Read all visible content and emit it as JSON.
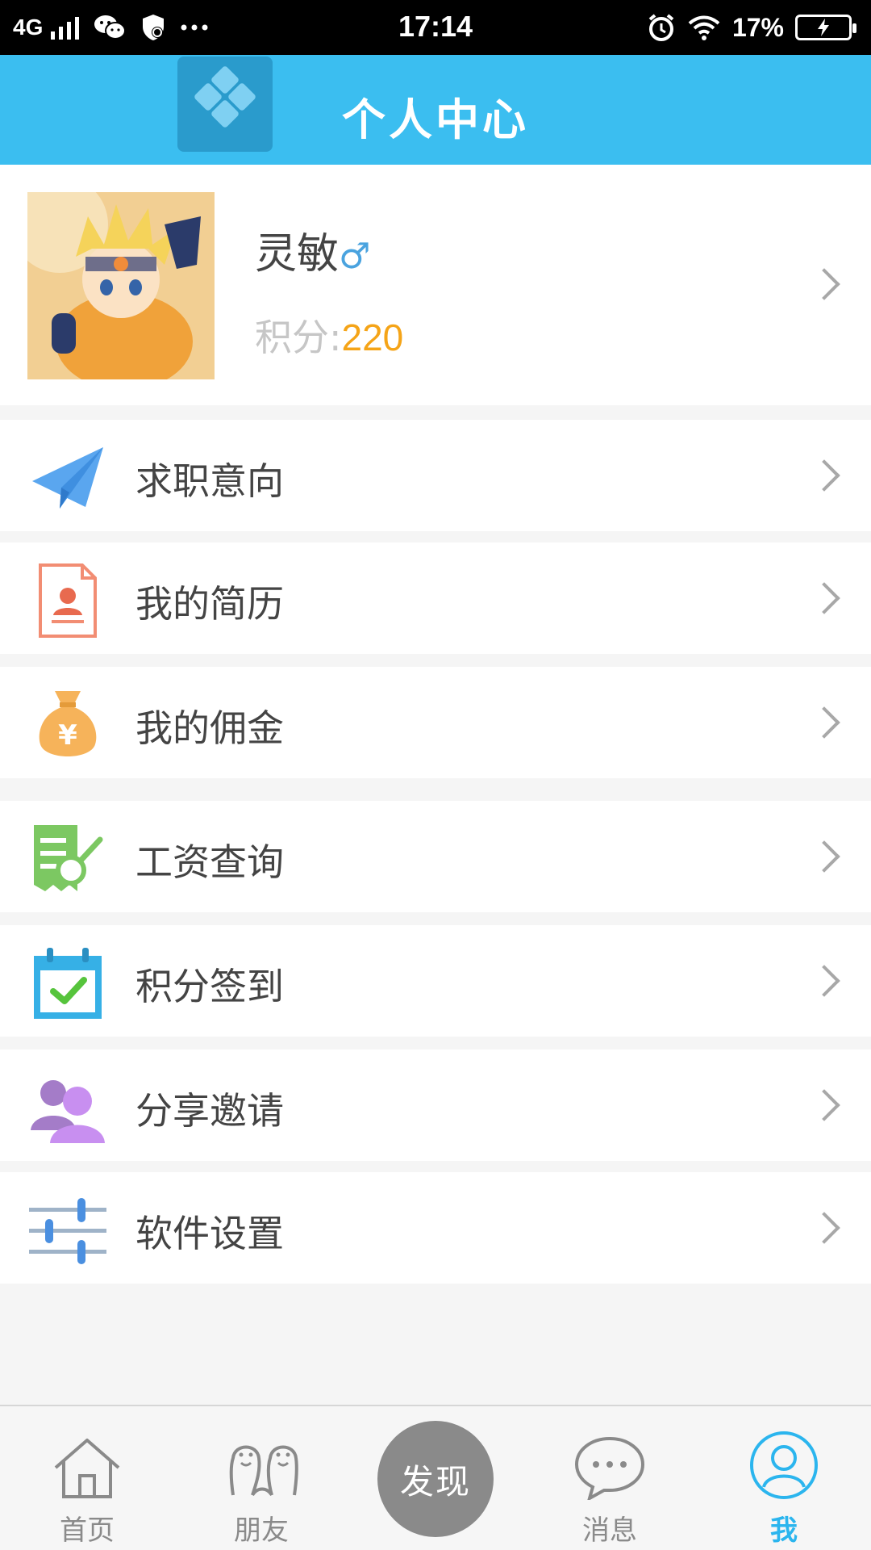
{
  "status_bar": {
    "network": "4G",
    "time": "17:14",
    "battery_percent": "17%",
    "icons": [
      "signal-icon",
      "wechat-icon",
      "shield-icon",
      "more-dots-icon",
      "alarm-icon",
      "wifi-icon",
      "battery-icon"
    ]
  },
  "header": {
    "title": "个人中心"
  },
  "profile": {
    "name": "灵敏",
    "gender_symbol": "♂",
    "points_label": "积分:",
    "points_value": "220"
  },
  "menu": [
    {
      "label": "求职意向",
      "icon": "paper-plane-icon",
      "color": "#5aa6ef"
    },
    {
      "label": "我的简历",
      "icon": "resume-icon",
      "color": "#f28d73"
    },
    {
      "label": "我的佣金",
      "icon": "money-bag-icon",
      "color": "#f6b35a"
    },
    {
      "label": "工资查询",
      "icon": "salary-search-icon",
      "color": "#7cc862"
    },
    {
      "label": "积分签到",
      "icon": "calendar-check-icon",
      "color": "#36b0e6"
    },
    {
      "label": "分享邀请",
      "icon": "people-icon",
      "color": "#b97ee0"
    },
    {
      "label": "软件设置",
      "icon": "sliders-icon",
      "color": "#4a8fe0"
    }
  ],
  "tabbar": {
    "tabs": [
      {
        "label": "首页",
        "icon": "home-icon"
      },
      {
        "label": "朋友",
        "icon": "friends-icon"
      },
      {
        "label": "发现",
        "icon": "discover-button"
      },
      {
        "label": "消息",
        "icon": "chat-icon"
      },
      {
        "label": "我",
        "icon": "user-icon",
        "active": true
      }
    ]
  },
  "colors": {
    "header_bg": "#3bbef0",
    "accent": "#2bb5ee",
    "points": "#f5a417"
  }
}
